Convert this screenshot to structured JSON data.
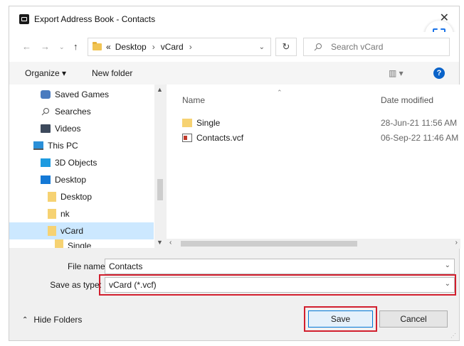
{
  "window": {
    "title": "Export Address Book - Contacts"
  },
  "address_bar": {
    "overflow": "«",
    "crumbs": [
      "Desktop",
      "vCard"
    ],
    "search_placeholder": "Search vCard"
  },
  "toolbar": {
    "organize": "Organize",
    "new_folder": "New folder",
    "help": "?"
  },
  "nav_items": [
    {
      "label": "Saved Games",
      "icon": "saved-games-icon"
    },
    {
      "label": "Searches",
      "icon": "search-icon"
    },
    {
      "label": "Videos",
      "icon": "video-icon"
    },
    {
      "label": "This PC",
      "icon": "computer-icon"
    },
    {
      "label": "3D Objects",
      "icon": "cube-icon"
    },
    {
      "label": "Desktop",
      "icon": "desktop-icon"
    },
    {
      "label": "Desktop",
      "icon": "folder-icon"
    },
    {
      "label": "nk",
      "icon": "folder-icon"
    },
    {
      "label": "vCard",
      "icon": "folder-icon",
      "selected": true
    },
    {
      "label": "Single",
      "icon": "folder-icon"
    }
  ],
  "columns": {
    "name": "Name",
    "date_modified": "Date modified"
  },
  "files": [
    {
      "name": "Single",
      "date": "28-Jun-21 11:56 AM",
      "icon": "folder-icon"
    },
    {
      "name": "Contacts.vcf",
      "date": "06-Sep-22 11:46 AM",
      "icon": "vcard-file-icon"
    }
  ],
  "form": {
    "file_name_label": "File name:",
    "file_name_value": "Contacts",
    "save_type_label": "Save as type:",
    "save_type_value": "vCard (*.vcf)"
  },
  "footer": {
    "hide_folders": "Hide Folders",
    "save": "Save",
    "cancel": "Cancel"
  },
  "colors": {
    "highlight_border": "#d21f2e",
    "selection": "#cce8ff",
    "help_blue": "#0a63c9"
  }
}
